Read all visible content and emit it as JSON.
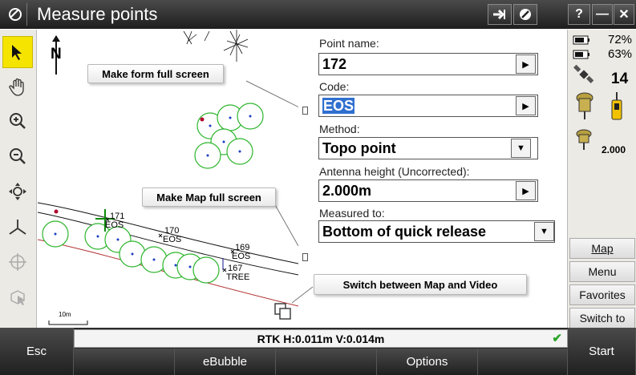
{
  "titlebar": {
    "title": "Measure points",
    "help": "?",
    "minimize": "—",
    "close": "✕"
  },
  "map": {
    "north": "N",
    "scale": "10m",
    "points": [
      {
        "name": "171",
        "code": "EOS"
      },
      {
        "name": "170",
        "code": "EOS"
      },
      {
        "name": "169",
        "code": "EOS"
      },
      {
        "name": "167",
        "code": "TREE"
      }
    ]
  },
  "form": {
    "point_name_label": "Point name:",
    "point_name": "172",
    "code_label": "Code:",
    "code": "EOS",
    "method_label": "Method:",
    "method": "Topo point",
    "antenna_label": "Antenna height (Uncorrected):",
    "antenna": "2.000m",
    "measured_to_label": "Measured to:",
    "measured_to": "Bottom of quick release"
  },
  "status": {
    "battery1": "72%",
    "battery2": "63%",
    "satellites": "14",
    "antenna_height": "2.000",
    "buttons": [
      "Map",
      "Menu",
      "Favorites",
      "Switch to"
    ]
  },
  "callouts": {
    "form_full": "Make form full screen",
    "map_full": "Make Map full screen",
    "switch": "Switch between Map and Video"
  },
  "bottom": {
    "rtk": "RTK H:0.011m V:0.014m",
    "esc": "Esc",
    "ebubble": "eBubble",
    "options": "Options",
    "start": "Start"
  }
}
